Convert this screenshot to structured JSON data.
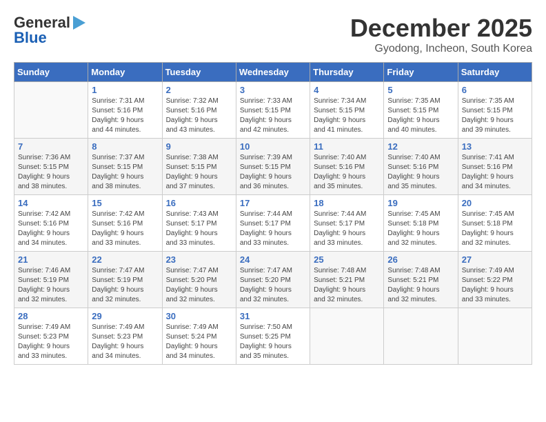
{
  "logo": {
    "line1": "General",
    "line2": "Blue"
  },
  "title": "December 2025",
  "location": "Gyodong, Incheon, South Korea",
  "headers": [
    "Sunday",
    "Monday",
    "Tuesday",
    "Wednesday",
    "Thursday",
    "Friday",
    "Saturday"
  ],
  "weeks": [
    [
      {
        "day": "",
        "info": ""
      },
      {
        "day": "1",
        "info": "Sunrise: 7:31 AM\nSunset: 5:16 PM\nDaylight: 9 hours\nand 44 minutes."
      },
      {
        "day": "2",
        "info": "Sunrise: 7:32 AM\nSunset: 5:16 PM\nDaylight: 9 hours\nand 43 minutes."
      },
      {
        "day": "3",
        "info": "Sunrise: 7:33 AM\nSunset: 5:15 PM\nDaylight: 9 hours\nand 42 minutes."
      },
      {
        "day": "4",
        "info": "Sunrise: 7:34 AM\nSunset: 5:15 PM\nDaylight: 9 hours\nand 41 minutes."
      },
      {
        "day": "5",
        "info": "Sunrise: 7:35 AM\nSunset: 5:15 PM\nDaylight: 9 hours\nand 40 minutes."
      },
      {
        "day": "6",
        "info": "Sunrise: 7:35 AM\nSunset: 5:15 PM\nDaylight: 9 hours\nand 39 minutes."
      }
    ],
    [
      {
        "day": "7",
        "info": "Sunrise: 7:36 AM\nSunset: 5:15 PM\nDaylight: 9 hours\nand 38 minutes."
      },
      {
        "day": "8",
        "info": "Sunrise: 7:37 AM\nSunset: 5:15 PM\nDaylight: 9 hours\nand 38 minutes."
      },
      {
        "day": "9",
        "info": "Sunrise: 7:38 AM\nSunset: 5:15 PM\nDaylight: 9 hours\nand 37 minutes."
      },
      {
        "day": "10",
        "info": "Sunrise: 7:39 AM\nSunset: 5:15 PM\nDaylight: 9 hours\nand 36 minutes."
      },
      {
        "day": "11",
        "info": "Sunrise: 7:40 AM\nSunset: 5:16 PM\nDaylight: 9 hours\nand 35 minutes."
      },
      {
        "day": "12",
        "info": "Sunrise: 7:40 AM\nSunset: 5:16 PM\nDaylight: 9 hours\nand 35 minutes."
      },
      {
        "day": "13",
        "info": "Sunrise: 7:41 AM\nSunset: 5:16 PM\nDaylight: 9 hours\nand 34 minutes."
      }
    ],
    [
      {
        "day": "14",
        "info": "Sunrise: 7:42 AM\nSunset: 5:16 PM\nDaylight: 9 hours\nand 34 minutes."
      },
      {
        "day": "15",
        "info": "Sunrise: 7:42 AM\nSunset: 5:16 PM\nDaylight: 9 hours\nand 33 minutes."
      },
      {
        "day": "16",
        "info": "Sunrise: 7:43 AM\nSunset: 5:17 PM\nDaylight: 9 hours\nand 33 minutes."
      },
      {
        "day": "17",
        "info": "Sunrise: 7:44 AM\nSunset: 5:17 PM\nDaylight: 9 hours\nand 33 minutes."
      },
      {
        "day": "18",
        "info": "Sunrise: 7:44 AM\nSunset: 5:17 PM\nDaylight: 9 hours\nand 33 minutes."
      },
      {
        "day": "19",
        "info": "Sunrise: 7:45 AM\nSunset: 5:18 PM\nDaylight: 9 hours\nand 32 minutes."
      },
      {
        "day": "20",
        "info": "Sunrise: 7:45 AM\nSunset: 5:18 PM\nDaylight: 9 hours\nand 32 minutes."
      }
    ],
    [
      {
        "day": "21",
        "info": "Sunrise: 7:46 AM\nSunset: 5:19 PM\nDaylight: 9 hours\nand 32 minutes."
      },
      {
        "day": "22",
        "info": "Sunrise: 7:47 AM\nSunset: 5:19 PM\nDaylight: 9 hours\nand 32 minutes."
      },
      {
        "day": "23",
        "info": "Sunrise: 7:47 AM\nSunset: 5:20 PM\nDaylight: 9 hours\nand 32 minutes."
      },
      {
        "day": "24",
        "info": "Sunrise: 7:47 AM\nSunset: 5:20 PM\nDaylight: 9 hours\nand 32 minutes."
      },
      {
        "day": "25",
        "info": "Sunrise: 7:48 AM\nSunset: 5:21 PM\nDaylight: 9 hours\nand 32 minutes."
      },
      {
        "day": "26",
        "info": "Sunrise: 7:48 AM\nSunset: 5:21 PM\nDaylight: 9 hours\nand 32 minutes."
      },
      {
        "day": "27",
        "info": "Sunrise: 7:49 AM\nSunset: 5:22 PM\nDaylight: 9 hours\nand 33 minutes."
      }
    ],
    [
      {
        "day": "28",
        "info": "Sunrise: 7:49 AM\nSunset: 5:23 PM\nDaylight: 9 hours\nand 33 minutes."
      },
      {
        "day": "29",
        "info": "Sunrise: 7:49 AM\nSunset: 5:23 PM\nDaylight: 9 hours\nand 34 minutes."
      },
      {
        "day": "30",
        "info": "Sunrise: 7:49 AM\nSunset: 5:24 PM\nDaylight: 9 hours\nand 34 minutes."
      },
      {
        "day": "31",
        "info": "Sunrise: 7:50 AM\nSunset: 5:25 PM\nDaylight: 9 hours\nand 35 minutes."
      },
      {
        "day": "",
        "info": ""
      },
      {
        "day": "",
        "info": ""
      },
      {
        "day": "",
        "info": ""
      }
    ]
  ]
}
